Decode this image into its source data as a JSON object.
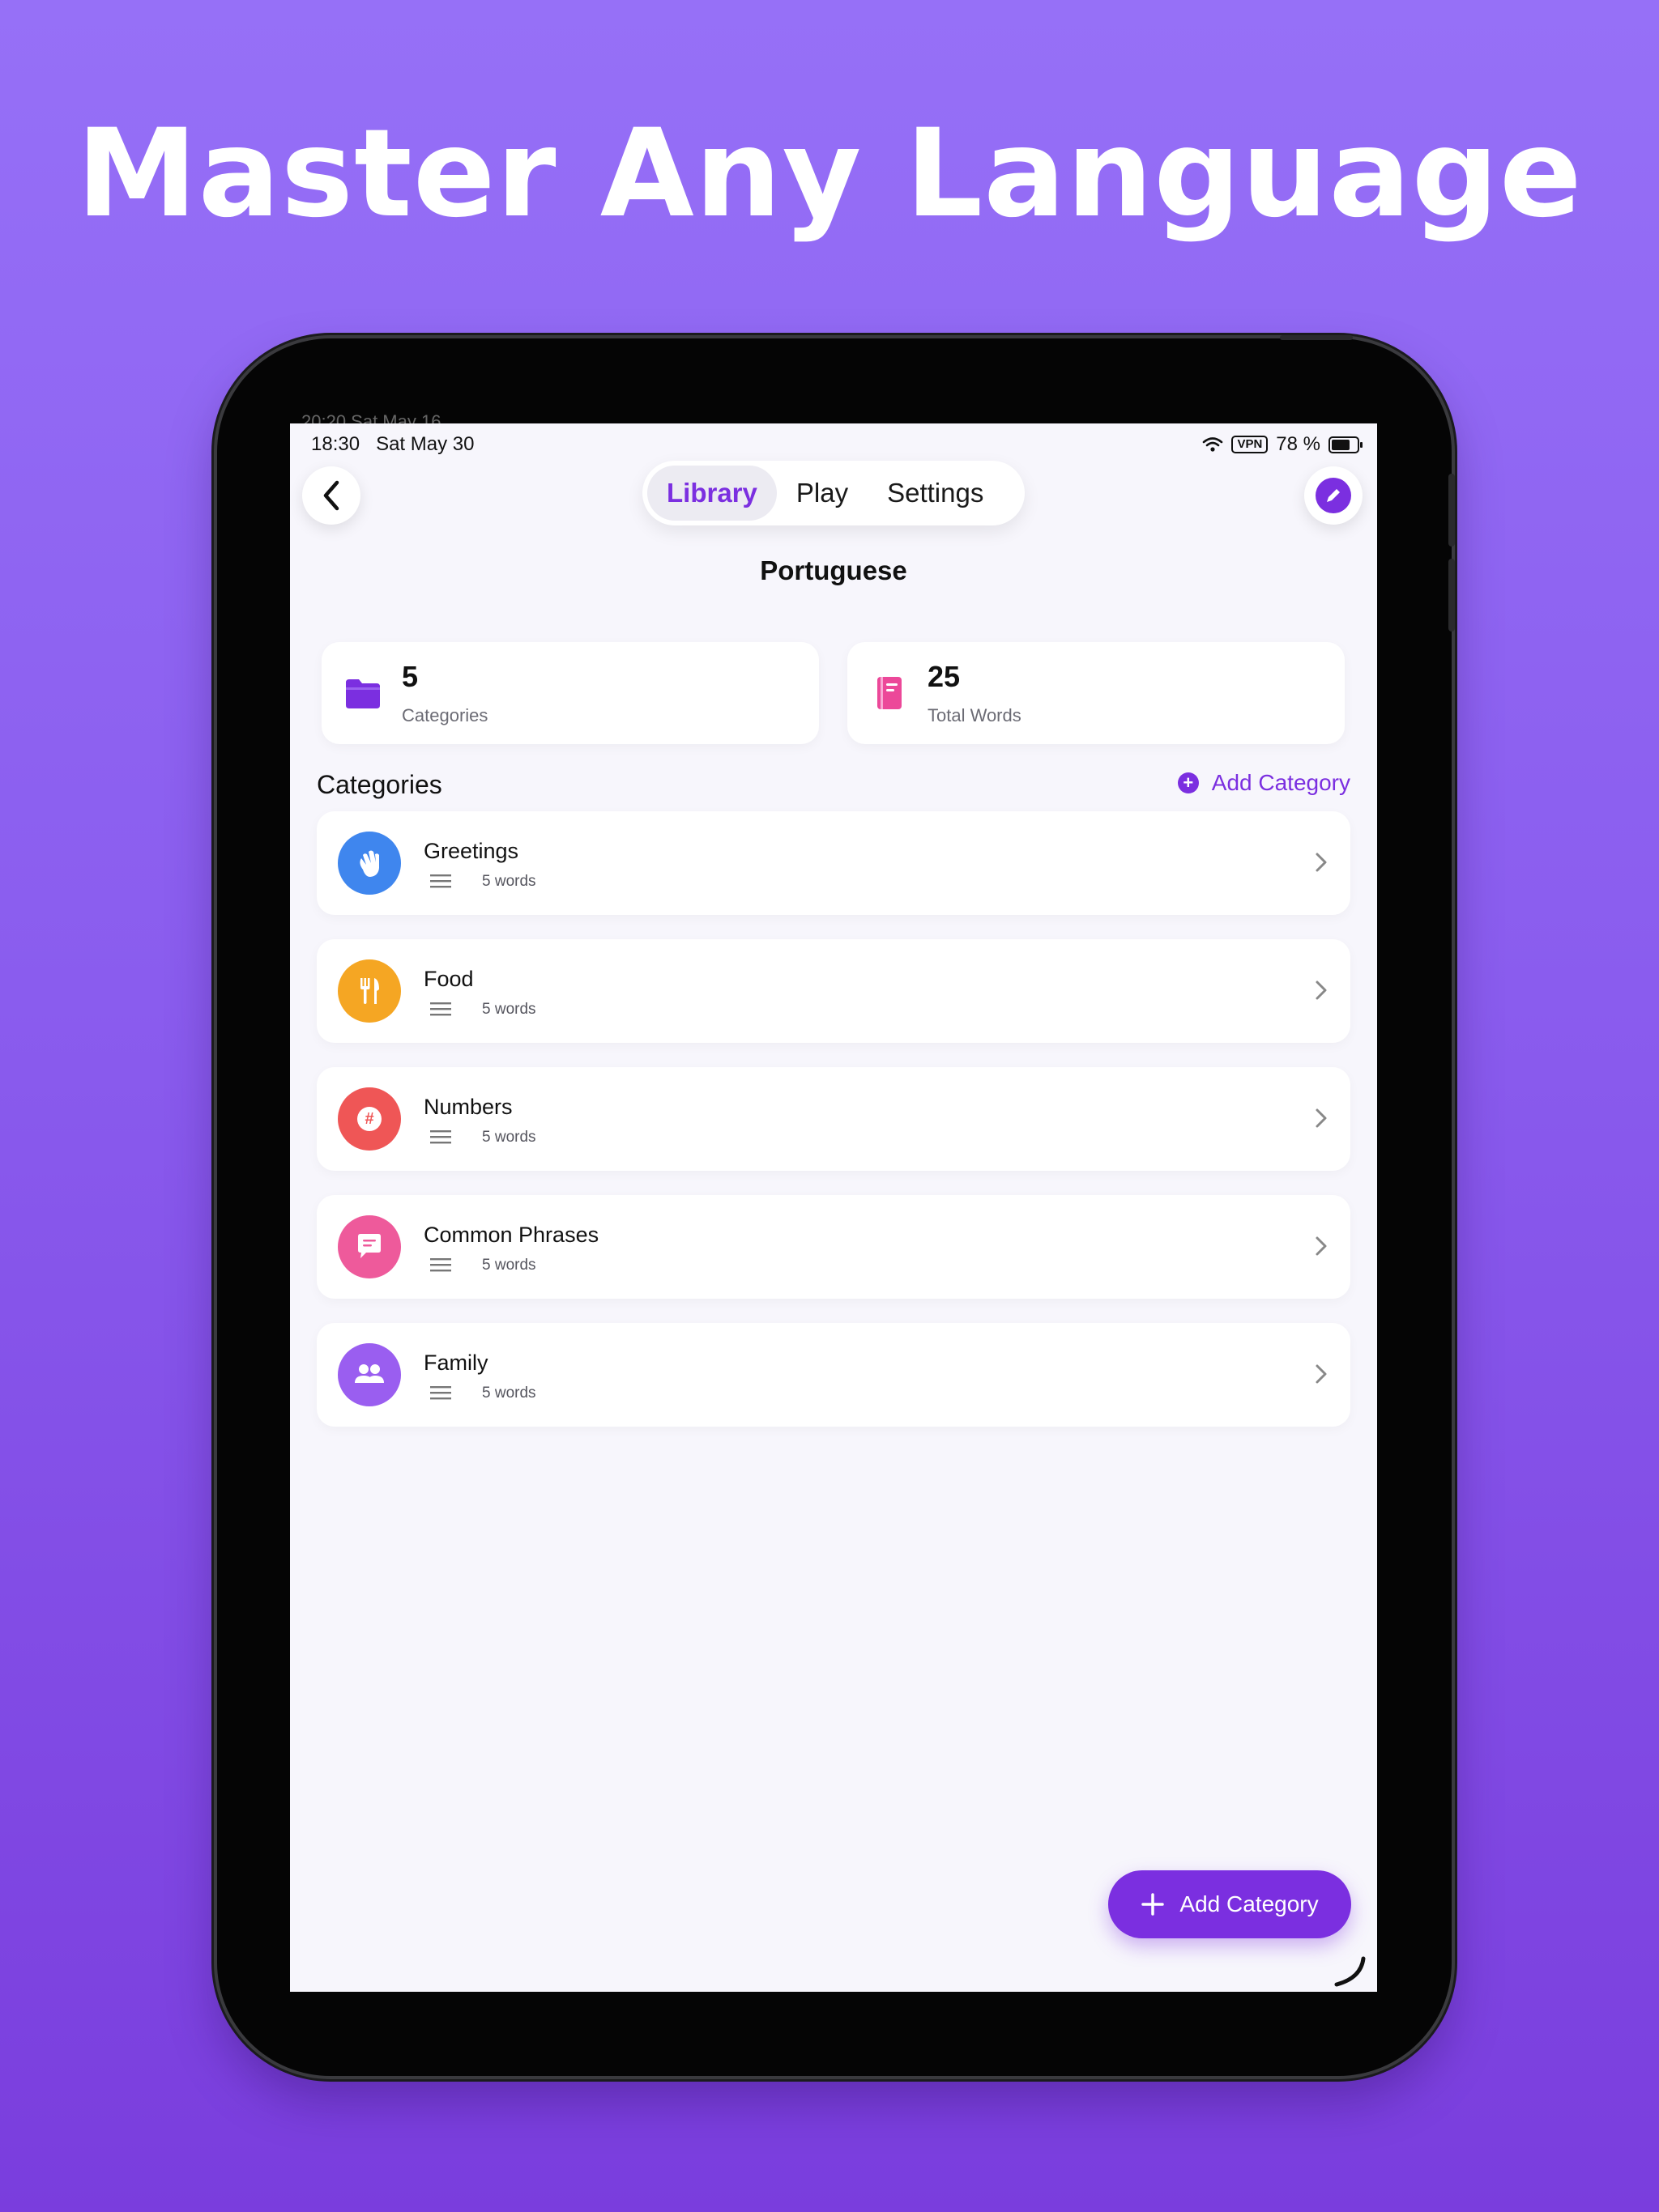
{
  "headline": "Master Any Language",
  "status_bar": {
    "time": "18:30",
    "date": "Sat May 30",
    "vpn_label": "VPN",
    "battery": "78 %",
    "ghost_text": "20:20  Sat May 16"
  },
  "nav": {
    "tabs": [
      {
        "label": "Library",
        "active": true
      },
      {
        "label": "Play",
        "active": false
      },
      {
        "label": "Settings",
        "active": false
      }
    ]
  },
  "page_title": "Portuguese",
  "stats": {
    "categories": {
      "value": "5",
      "label": "Categories"
    },
    "words": {
      "value": "25",
      "label": "Total Words"
    }
  },
  "section": {
    "title": "Categories",
    "add_label": "Add Category"
  },
  "categories": [
    {
      "name": "Greetings",
      "count": "5 words",
      "icon": "waving-hand-icon",
      "color": "#3f86ee"
    },
    {
      "name": "Food",
      "count": "5 words",
      "icon": "fork-knife-icon",
      "color": "#f5a623"
    },
    {
      "name": "Numbers",
      "count": "5 words",
      "icon": "hashtag-icon",
      "color": "#ef5656"
    },
    {
      "name": "Common Phrases",
      "count": "5 words",
      "icon": "chat-bubble-icon",
      "color": "#ee5a9b"
    },
    {
      "name": "Family",
      "count": "5 words",
      "icon": "people-icon",
      "color": "#9a5ef0"
    }
  ],
  "fab": {
    "label": "Add Category"
  },
  "colors": {
    "accent": "#7b2fe0",
    "background_top": "#9670f7",
    "background_bottom": "#7a3ddd"
  }
}
